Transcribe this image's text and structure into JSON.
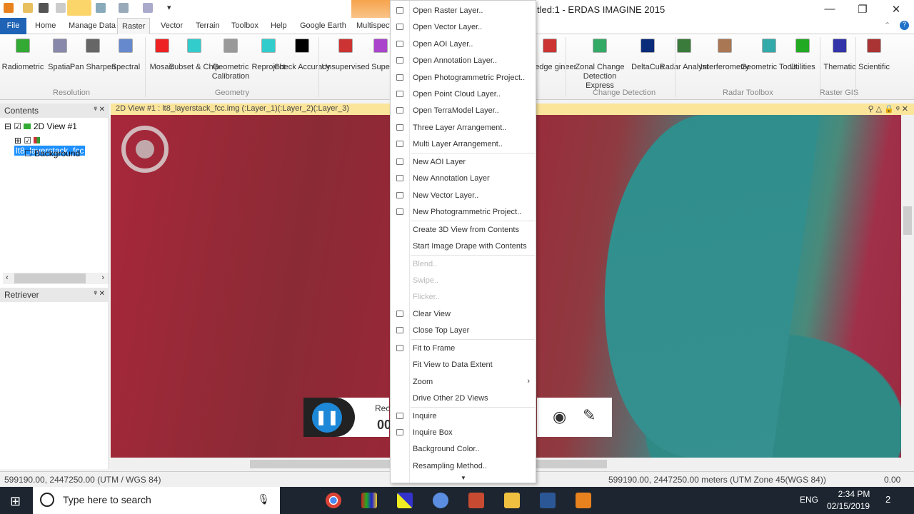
{
  "window": {
    "title": "tled:1 - ERDAS IMAGINE 2015",
    "minimize": "—",
    "restore": "❐",
    "close": "✕"
  },
  "tabs": [
    "File",
    "Home",
    "Manage Data",
    "Raster",
    "Vector",
    "Terrain",
    "Toolbox",
    "Help",
    "Google Earth",
    "Multispect"
  ],
  "active_tab": "Raster",
  "ribbon": {
    "buttons": [
      "Radiometric",
      "Spatial",
      "Pan Sharpen",
      "Spectral",
      "Mosaic",
      "Subset & Chip",
      "Geometric Calibration",
      "Reproject",
      "Check Accuracy",
      "Unsupervised",
      "Supe",
      "owledge gineer",
      "Zonal Change Detection Express",
      "DeltaCue",
      "Radar Analyst",
      "Interferometry",
      "Geometric Tools",
      "Utilities",
      "Thematic",
      "Scientific"
    ],
    "groups": [
      "Resolution",
      "Geometry",
      "Change Detection",
      "Radar Toolbox",
      "Raster GIS"
    ]
  },
  "contents": {
    "title": "Contents",
    "tree": [
      "2D View #1",
      "lt8_layerstack_fcc",
      "Background"
    ]
  },
  "retriever": {
    "title": "Retriever"
  },
  "view": {
    "header": "2D View #1 : lt8_layerstack_fcc.img (:Layer_1)(:Layer_2)(:Layer_3)"
  },
  "menu": {
    "items": [
      {
        "label": "Open Raster Layer..",
        "icon": "raster-icon"
      },
      {
        "label": "Open Vector Layer..",
        "icon": "vector-icon"
      },
      {
        "label": "Open AOI Layer..",
        "icon": "aoi-icon"
      },
      {
        "label": "Open Annotation Layer..",
        "icon": "annotation-icon"
      },
      {
        "label": "Open Photogrammetric Project..",
        "icon": "photogrammetry-icon"
      },
      {
        "label": "Open Point Cloud Layer..",
        "icon": "point-cloud-icon"
      },
      {
        "label": "Open TerraModel Layer..",
        "icon": "terramodel-icon"
      },
      {
        "label": "Three Layer Arrangement..",
        "icon": "three-layer-icon"
      },
      {
        "label": "Multi Layer Arrangement..",
        "icon": "multi-layer-icon",
        "sep": true
      },
      {
        "label": "New AOI Layer",
        "icon": "new-aoi-icon"
      },
      {
        "label": "New Annotation Layer",
        "icon": "new-annotation-icon"
      },
      {
        "label": "New Vector Layer..",
        "icon": "new-vector-icon"
      },
      {
        "label": "New Photogrammetric Project..",
        "icon": "new-photogrammetry-icon",
        "sep": true
      },
      {
        "label": "Create 3D View from Contents"
      },
      {
        "label": "Start Image Drape with Contents",
        "sep": true
      },
      {
        "label": "Blend..",
        "disabled": true
      },
      {
        "label": "Swipe..",
        "disabled": true
      },
      {
        "label": "Flicker..",
        "disabled": true
      },
      {
        "label": "Clear View",
        "icon": "eraser-icon"
      },
      {
        "label": "Close Top Layer",
        "icon": "close-layer-icon",
        "sep": true
      },
      {
        "label": "Fit to Frame",
        "icon": "fit-frame-icon"
      },
      {
        "label": "Fit View to Data Extent"
      },
      {
        "label": "Zoom",
        "submenu": true
      },
      {
        "label": "Drive Other 2D Views",
        "sep": true
      },
      {
        "label": "Inquire",
        "icon": "crosshair-icon"
      },
      {
        "label": "Inquire Box",
        "icon": "inquire-box-icon"
      },
      {
        "label": "Background Color.."
      },
      {
        "label": "Resampling Method.."
      }
    ]
  },
  "recorder": {
    "label": "Rec",
    "time": "00"
  },
  "status": {
    "left": "599190.00, 2447250.00   (UTM / WGS 84)",
    "right": "599190.00, 2447250.00 meters (UTM Zone 45(WGS 84))",
    "value": "0.00"
  },
  "taskbar": {
    "search_placeholder": "Type here to search",
    "lang": "ENG",
    "time": "2:34 PM",
    "date": "02/15/2019",
    "notif": "2"
  }
}
